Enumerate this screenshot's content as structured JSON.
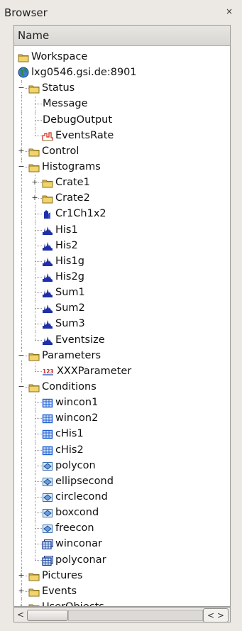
{
  "window": {
    "title": "Browser",
    "close_glyph": "×"
  },
  "tree_header": "Name",
  "tree": [
    {
      "label": "Workspace",
      "icon": "folder-icon",
      "depth": 0
    },
    {
      "label": "lxg0546.gsi.de:8901",
      "icon": "globe-icon",
      "depth": 0
    },
    {
      "label": "Status",
      "icon": "folder-icon",
      "depth": 1,
      "toggle": "minus"
    },
    {
      "label": "Message",
      "icon": "none",
      "depth": 2
    },
    {
      "label": "DebugOutput",
      "icon": "none",
      "depth": 2
    },
    {
      "label": "EventsRate",
      "icon": "ratemeter-icon",
      "depth": 2
    },
    {
      "label": "Control",
      "icon": "folder-icon",
      "depth": 1,
      "toggle": "plus"
    },
    {
      "label": "Histograms",
      "icon": "folder-icon",
      "depth": 1,
      "toggle": "minus"
    },
    {
      "label": "Crate1",
      "icon": "folder-icon",
      "depth": 2,
      "toggle": "plus"
    },
    {
      "label": "Crate2",
      "icon": "folder-icon",
      "depth": 2,
      "toggle": "plus"
    },
    {
      "label": "Cr1Ch1x2",
      "icon": "histogram2d-icon",
      "depth": 2
    },
    {
      "label": "His1",
      "icon": "histogram-icon",
      "depth": 2
    },
    {
      "label": "His2",
      "icon": "histogram-icon",
      "depth": 2
    },
    {
      "label": "His1g",
      "icon": "histogram-icon",
      "depth": 2
    },
    {
      "label": "His2g",
      "icon": "histogram-icon",
      "depth": 2
    },
    {
      "label": "Sum1",
      "icon": "histogram-icon",
      "depth": 2
    },
    {
      "label": "Sum2",
      "icon": "histogram-icon",
      "depth": 2
    },
    {
      "label": "Sum3",
      "icon": "histogram-icon",
      "depth": 2
    },
    {
      "label": "Eventsize",
      "icon": "histogram-icon",
      "depth": 2
    },
    {
      "label": "Parameters",
      "icon": "folder-icon",
      "depth": 1,
      "toggle": "minus"
    },
    {
      "label": "XXXParameter",
      "icon": "parameter-icon",
      "depth": 2
    },
    {
      "label": "Conditions",
      "icon": "folder-icon",
      "depth": 1,
      "toggle": "minus"
    },
    {
      "label": "wincon1",
      "icon": "window-condition-icon",
      "depth": 2
    },
    {
      "label": "wincon2",
      "icon": "window-condition-icon",
      "depth": 2
    },
    {
      "label": "cHis1",
      "icon": "window-condition-icon",
      "depth": 2
    },
    {
      "label": "cHis2",
      "icon": "window-condition-icon",
      "depth": 2
    },
    {
      "label": "polycon",
      "icon": "polygon-condition-icon",
      "depth": 2
    },
    {
      "label": "ellipsecond",
      "icon": "polygon-condition-icon",
      "depth": 2
    },
    {
      "label": "circlecond",
      "icon": "polygon-condition-icon",
      "depth": 2
    },
    {
      "label": "boxcond",
      "icon": "polygon-condition-icon",
      "depth": 2
    },
    {
      "label": "freecon",
      "icon": "polygon-condition-icon",
      "depth": 2
    },
    {
      "label": "winconar",
      "icon": "condition-array-icon",
      "depth": 2
    },
    {
      "label": "polyconar",
      "icon": "condition-array-icon",
      "depth": 2
    },
    {
      "label": "Pictures",
      "icon": "folder-icon",
      "depth": 1,
      "toggle": "plus"
    },
    {
      "label": "Events",
      "icon": "folder-icon",
      "depth": 1,
      "toggle": "plus"
    },
    {
      "label": "UserObjects",
      "icon": "folder-icon",
      "depth": 1,
      "toggle": "plus"
    }
  ],
  "scrollbar": {
    "left_arrow": "<",
    "arrows": "< >"
  },
  "colors": {
    "folder": "#f2d46a",
    "folder_stroke": "#8a7020",
    "histogram": "#1f2fa8",
    "condition": "#1f5fd0",
    "globe": "#2e8a2e"
  }
}
